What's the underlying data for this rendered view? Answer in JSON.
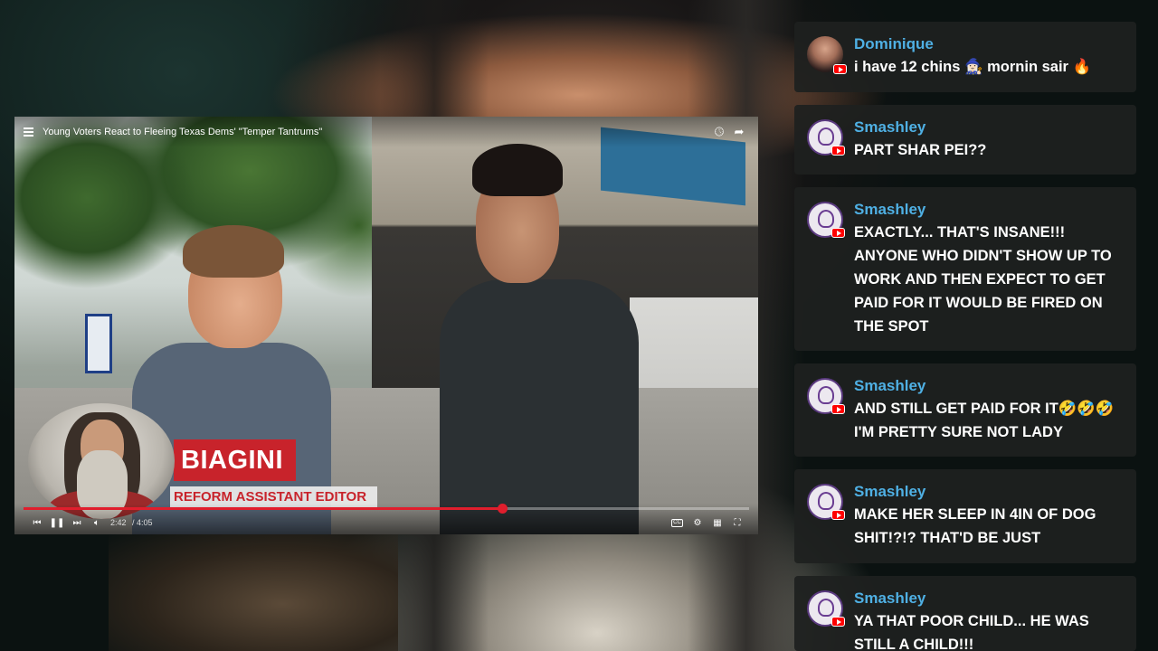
{
  "video": {
    "title": "Young Voters React to Fleeing Texas Dems' \"Temper Tantrums\"",
    "lower_third_name": "BIAGINI",
    "lower_third_role": "REFORM ASSISTANT EDITOR",
    "time_current": "2:42",
    "time_total": "4:05",
    "progress_fraction": 0.66,
    "icons": {
      "menu": "menu-icon",
      "watch_later": "clock-icon",
      "share": "share-icon",
      "prev": "previous-icon",
      "pause": "pause-icon",
      "next": "next-icon",
      "volume": "volume-icon",
      "captions": "cc-icon",
      "settings": "gear-icon",
      "cast": "cast-icon",
      "fullscreen": "fullscreen-icon"
    },
    "colors": {
      "accent": "#e01e2d",
      "lower_third": "#c8232b"
    }
  },
  "chat": {
    "name_color": "#4fb0e4",
    "messages": [
      {
        "author": "Dominique",
        "text": "i have 12 chins 🧙🏻‍♀️ mornin sair 🔥",
        "avatar": "photo"
      },
      {
        "author": "Smashley",
        "text": "PART SHAR PEI??",
        "avatar": "logo"
      },
      {
        "author": "Smashley",
        "text": "EXACTLY... THAT'S INSANE!!! ANYONE WHO DIDN'T SHOW UP TO WORK AND THEN EXPECT TO GET PAID FOR IT WOULD BE FIRED ON THE SPOT",
        "avatar": "logo"
      },
      {
        "author": "Smashley",
        "text": "AND STILL GET PAID FOR IT🤣🤣🤣 I'M PRETTY SURE NOT LADY",
        "avatar": "logo"
      },
      {
        "author": "Smashley",
        "text": "MAKE HER SLEEP IN 4IN OF DOG SHIT!?!? THAT'D BE JUST",
        "avatar": "logo"
      },
      {
        "author": "Smashley",
        "text": "YA THAT POOR CHILD... HE WAS STILL A CHILD!!!",
        "avatar": "logo"
      }
    ]
  }
}
